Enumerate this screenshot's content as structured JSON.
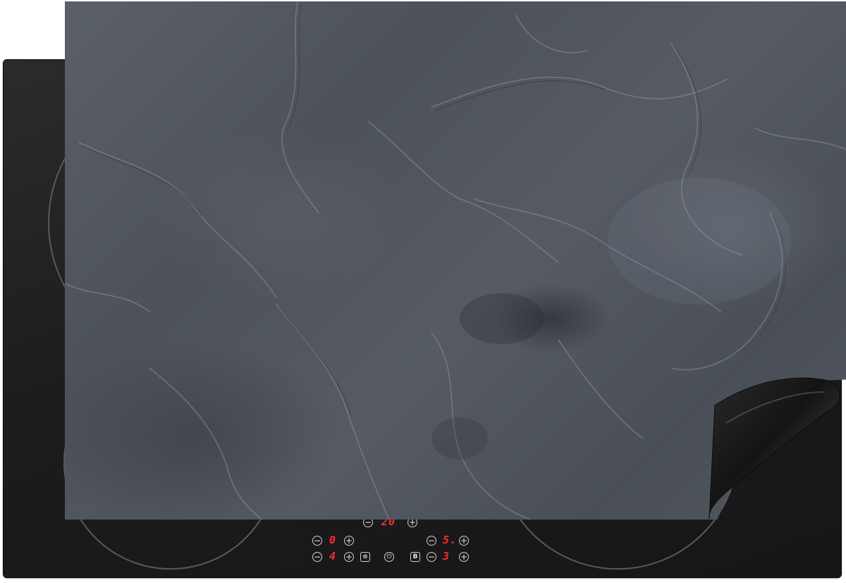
{
  "hob": {
    "zone_top_center_left": "−",
    "zone_top_center_display": "20",
    "zone_top_center_right": "+",
    "zone_left_upper_minus": "−",
    "zone_left_upper_display": "0",
    "zone_left_upper_plus": "+",
    "zone_right_upper_minus": "−",
    "zone_right_upper_display": "5.",
    "zone_right_upper_plus": "+",
    "zone_left_lower_minus": "−",
    "zone_left_lower_display": "4",
    "zone_left_lower_plus": "+",
    "zone_right_lower_minus": "−",
    "zone_right_lower_display": "3",
    "zone_right_lower_plus": "+",
    "lock_symbol": "⊕",
    "power_symbol": "⏻",
    "boost_symbol": "B"
  },
  "colors": {
    "glass": "#1c1c1e",
    "mat_slate": "#52575f",
    "display_red": "#ff2b2b",
    "ring": "#5a5a5c"
  }
}
